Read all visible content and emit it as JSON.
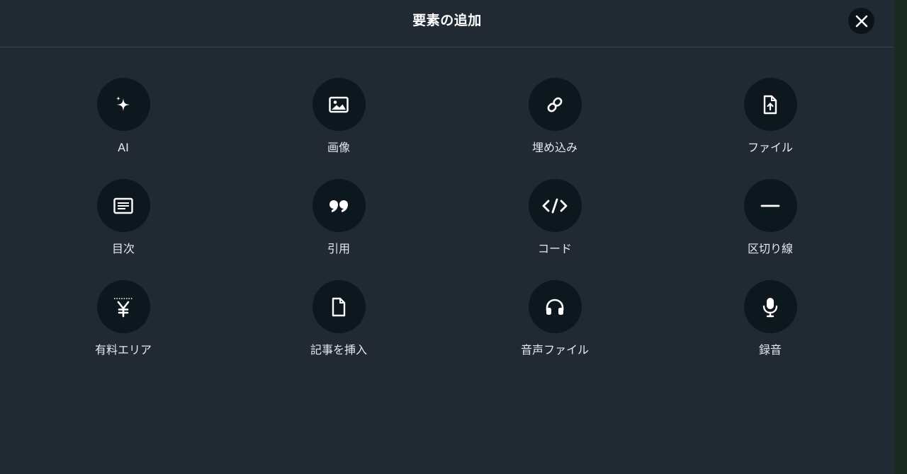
{
  "dialog": {
    "title": "要素の追加"
  },
  "items": [
    {
      "label": "AI",
      "icon": "sparkle-icon"
    },
    {
      "label": "画像",
      "icon": "image-icon"
    },
    {
      "label": "埋め込み",
      "icon": "link-icon"
    },
    {
      "label": "ファイル",
      "icon": "file-upload-icon"
    },
    {
      "label": "目次",
      "icon": "table-of-contents-icon"
    },
    {
      "label": "引用",
      "icon": "quote-icon"
    },
    {
      "label": "コード",
      "icon": "code-icon"
    },
    {
      "label": "区切り線",
      "icon": "divider-icon"
    },
    {
      "label": "有料エリア",
      "icon": "yen-paywall-icon"
    },
    {
      "label": "記事を挿入",
      "icon": "document-icon"
    },
    {
      "label": "音声ファイル",
      "icon": "headphones-icon"
    },
    {
      "label": "録音",
      "icon": "microphone-icon"
    }
  ],
  "colors": {
    "panel_bg": "#212a33",
    "circle_bg": "#0d171e",
    "text": "#e6e9ec"
  }
}
